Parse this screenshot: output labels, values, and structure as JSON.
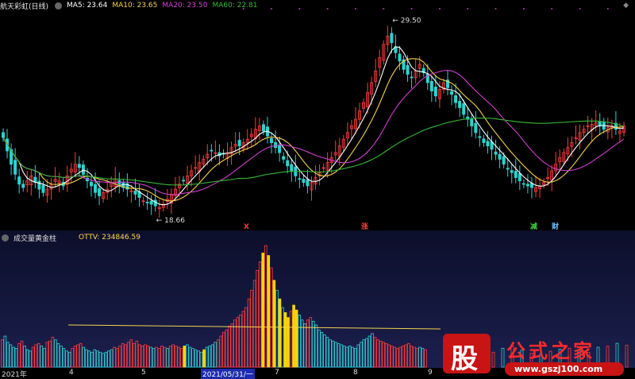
{
  "stock": {
    "name": "航天彩虹(日线)"
  },
  "ma_legend": [
    {
      "label": "MA5: 23.64",
      "color": "#ffffff"
    },
    {
      "label": "MA10: 23.65",
      "color": "#f4d34b"
    },
    {
      "label": "MA20: 23.50",
      "color": "#d040d0"
    },
    {
      "label": "MA60: 22.81",
      "color": "#35b735"
    }
  ],
  "indicator": {
    "name": "成交量黄金柱",
    "value_label": "OTTV: 234846.59",
    "value_color": "#ffd84a"
  },
  "annotations": {
    "high": "29.50",
    "low": "18.66"
  },
  "markers": [
    {
      "text": "X",
      "color": "#ff3b3b"
    },
    {
      "text": "涨",
      "color": "#ff3b3b"
    },
    {
      "text": "减",
      "color": "#3bd63b"
    },
    {
      "text": "财",
      "color": "#6cc0ff"
    }
  ],
  "xaxis": [
    "2021年",
    "4",
    "5",
    "2021/05/31/一",
    "7",
    "8",
    "9"
  ],
  "watermark": {
    "glyph": "股",
    "name": "公式之家",
    "url": "www.gszj100.com"
  },
  "colors": {
    "up": "#ff3b3b",
    "down": "#2cd3d3",
    "gold": "#ffd500",
    "ma60": "#35b735",
    "ma5": "#ffffff",
    "ma10": "#f4d34b",
    "ma20": "#d040d0"
  },
  "chart_data": {
    "type": "candlestick",
    "y_price_range": [
      17.8,
      30.5
    ],
    "closes": [
      22.9,
      22.1,
      21.3,
      20.7,
      20.1,
      19.9,
      20.3,
      20.6,
      20.2,
      19.8,
      19.6,
      19.8,
      20.1,
      20.4,
      20.3,
      20.0,
      20.6,
      21.0,
      21.3,
      21.1,
      20.7,
      20.3,
      20.0,
      19.6,
      19.4,
      19.6,
      19.8,
      20.2,
      20.4,
      20.1,
      19.9,
      19.8,
      19.7,
      19.5,
      19.3,
      19.1,
      19.0,
      18.9,
      18.8,
      18.7,
      18.9,
      19.2,
      19.5,
      19.8,
      20.1,
      20.3,
      20.6,
      20.9,
      21.1,
      21.4,
      21.6,
      21.9,
      22.1,
      22.0,
      21.8,
      21.9,
      22.0,
      22.3,
      22.5,
      22.4,
      22.6,
      22.8,
      23.1,
      23.4,
      23.6,
      23.3,
      23.0,
      22.6,
      22.3,
      22.0,
      21.6,
      21.2,
      20.9,
      20.6,
      20.4,
      20.2,
      20.0,
      20.2,
      20.5,
      20.8,
      21.1,
      21.4,
      21.7,
      22.0,
      22.4,
      22.8,
      23.2,
      23.6,
      24.0,
      24.5,
      25.0,
      25.6,
      26.2,
      26.9,
      27.7,
      28.5,
      29.0,
      28.6,
      28.0,
      27.5,
      27.0,
      26.7,
      26.5,
      26.9,
      27.3,
      26.8,
      26.2,
      25.7,
      25.4,
      25.8,
      26.2,
      25.9,
      25.5,
      25.0,
      24.7,
      24.3,
      24.0,
      23.6,
      23.2,
      22.9,
      22.6,
      22.4,
      22.2,
      21.9,
      21.6,
      21.3,
      21.0,
      20.8,
      20.5,
      20.3,
      20.1,
      20.0,
      19.9,
      19.9,
      20.0,
      20.2,
      20.5,
      20.9,
      21.3,
      21.7,
      22.0,
      22.3,
      22.6,
      22.9,
      23.2,
      23.4,
      23.6,
      23.7,
      23.8,
      23.6,
      23.4,
      23.5,
      23.6,
      23.4,
      23.3,
      23.6
    ],
    "volume_range": [
      0,
      100
    ],
    "volumes": [
      22,
      25,
      20,
      18,
      16,
      15,
      19,
      21,
      17,
      14,
      13,
      16,
      18,
      19,
      17,
      15,
      20,
      21,
      24,
      22,
      19,
      17,
      15,
      13,
      12,
      15,
      17,
      18,
      19,
      16,
      14,
      13,
      12,
      14,
      13,
      12,
      11,
      12,
      13,
      14,
      16,
      15,
      17,
      19,
      18,
      20,
      22,
      19,
      21,
      18,
      17,
      18,
      17,
      16,
      15,
      16,
      15,
      17,
      16,
      15,
      17,
      18,
      17,
      16,
      15,
      17,
      18,
      16,
      15,
      14,
      13,
      12,
      14,
      16,
      17,
      18,
      20,
      22,
      25,
      28,
      30,
      33,
      35,
      38,
      40,
      42,
      45,
      48,
      55,
      62,
      70,
      78,
      85,
      92,
      98,
      90,
      80,
      70,
      62,
      55,
      48,
      44,
      40,
      45,
      50,
      46,
      42,
      38,
      35,
      38,
      40,
      37,
      34,
      30,
      28,
      26,
      24,
      22,
      21,
      20,
      19,
      18,
      17,
      16,
      17,
      16,
      15,
      18,
      20,
      22,
      23,
      25,
      27,
      24,
      22,
      21,
      20,
      19,
      18,
      17,
      16,
      15,
      16,
      17,
      18,
      19,
      17,
      16,
      15,
      16,
      15,
      14
    ],
    "gold_indices": [
      65,
      72,
      93,
      95,
      97,
      99,
      101,
      102,
      104,
      105
    ],
    "ottv_line": [
      6.5,
      5.2
    ],
    "ma_series": [
      "MA5",
      "MA10",
      "MA20",
      "MA60"
    ]
  }
}
